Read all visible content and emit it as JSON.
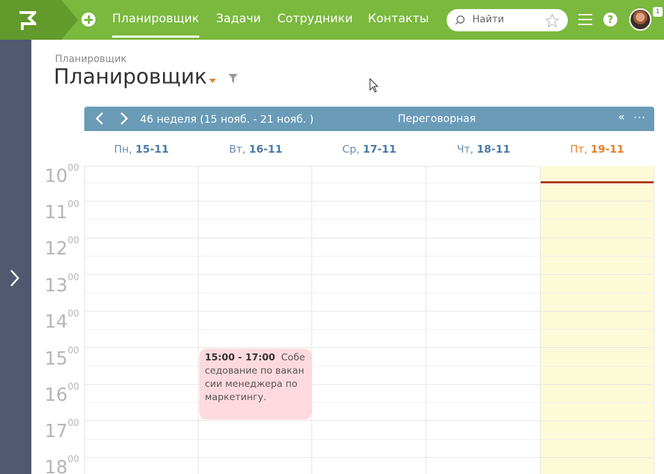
{
  "topbar": {
    "nav": [
      "Планировщик",
      "Задачи",
      "Сотрудники",
      "Контакты"
    ],
    "active_nav": "Планировщик",
    "search_placeholder": "Найти",
    "notification_count": "1",
    "help_label": "?",
    "brand_color": "#7ab83e"
  },
  "page": {
    "breadcrumb": "Планировщик",
    "title": "Планировщик"
  },
  "calendar": {
    "week_label": "46 неделя  (15 нояб. - 21 нояб. )",
    "room": "Переговорная",
    "collapse_label": "«",
    "more_label": "···",
    "days": [
      {
        "name": "Пн,",
        "date": "15-11"
      },
      {
        "name": "Вт,",
        "date": "16-11"
      },
      {
        "name": "Ср,",
        "date": "17-11"
      },
      {
        "name": "Чт,",
        "date": "18-11"
      },
      {
        "name": "Пт,",
        "date": "19-11"
      }
    ],
    "today_index": 4,
    "hours": [
      {
        "h": "10",
        "m": "00"
      },
      {
        "h": "11",
        "m": "00"
      },
      {
        "h": "12",
        "m": "00"
      },
      {
        "h": "13",
        "m": "00"
      },
      {
        "h": "14",
        "m": "00"
      },
      {
        "h": "15",
        "m": "00"
      },
      {
        "h": "16",
        "m": "00"
      },
      {
        "h": "17",
        "m": "00"
      },
      {
        "h": "18",
        "m": "00"
      }
    ],
    "event": {
      "time": "15:00 - 17:00",
      "title": "Собеседование по вакансии менеджера по маркетингу.",
      "color": "#fedadf"
    },
    "today_color": "#fdfad8",
    "now_line_color": "#b03a22"
  }
}
